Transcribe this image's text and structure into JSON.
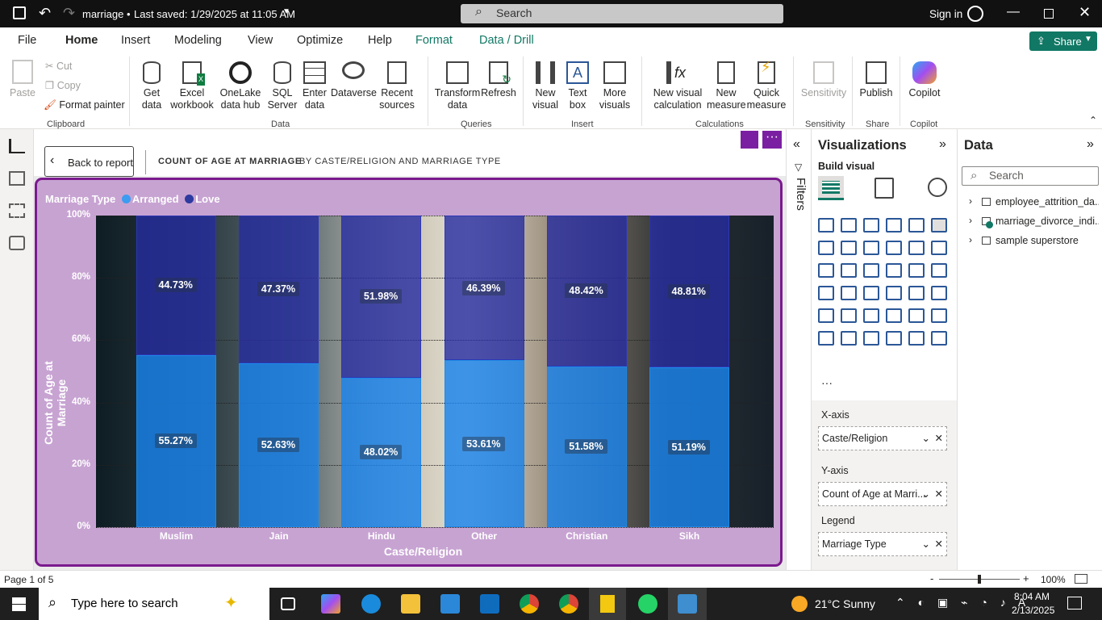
{
  "titlebar": {
    "file": "marriage",
    "saved": "Last saved: 1/29/2025 at 11:05 AM",
    "search": "Search",
    "signin": "Sign in"
  },
  "menu": {
    "file": "File",
    "home": "Home",
    "insert": "Insert",
    "modeling": "Modeling",
    "view": "View",
    "optimize": "Optimize",
    "help": "Help",
    "format": "Format",
    "datadrill": "Data / Drill",
    "share": "Share"
  },
  "ribbon": {
    "paste": "Paste",
    "cut": "Cut",
    "copy": "Copy",
    "format_painter": "Format painter",
    "clipboard": "Clipboard",
    "get_data": "Get data",
    "excel": "Excel workbook",
    "onelake": "OneLake data hub",
    "sql": "SQL Server",
    "enter": "Enter data",
    "dataverse": "Dataverse",
    "recent": "Recent sources",
    "data_grp": "Data",
    "transform": "Transform data",
    "refresh": "Refresh",
    "queries": "Queries",
    "new_visual": "New visual",
    "text_box": "Text box",
    "more_visuals": "More visuals",
    "insert_grp": "Insert",
    "new_calc": "New visual calculation",
    "new_measure": "New measure",
    "quick_measure": "Quick measure",
    "calc_grp": "Calculations",
    "sensitivity": "Sensitivity",
    "sens_grp": "Sensitivity",
    "publish": "Publish",
    "share_grp": "Share",
    "copilot": "Copilot",
    "copilot_grp": "Copilot"
  },
  "header": {
    "back": "Back to report",
    "title": "COUNT OF AGE AT MARRIAGE",
    "subtitle": "BY CASTE/RELIGION AND MARRIAGE TYPE"
  },
  "chart_data": {
    "type": "bar",
    "stacked": "100%",
    "legend_title": "Marriage Type",
    "categories": [
      "Muslim",
      "Jain",
      "Hindu",
      "Other",
      "Christian",
      "Sikh"
    ],
    "series": [
      {
        "name": "Arranged",
        "color": "#1e88e5",
        "values": [
          55.27,
          52.63,
          48.02,
          53.61,
          51.58,
          51.19
        ]
      },
      {
        "name": "Love",
        "color": "#283593",
        "values": [
          44.73,
          47.37,
          51.98,
          46.39,
          48.42,
          48.81
        ]
      }
    ],
    "data_labels_arranged": [
      "55.27%",
      "52.63%",
      "48.02%",
      "53.61%",
      "51.58%",
      "51.19%"
    ],
    "data_labels_love": [
      "44.73%",
      "47.37%",
      "51.98%",
      "46.39%",
      "48.42%",
      "48.81%"
    ],
    "yticks": [
      "100%",
      "80%",
      "60%",
      "40%",
      "20%",
      "0%"
    ],
    "ylim": [
      0,
      100
    ],
    "xlabel": "Caste/Religion",
    "ylabel": "Count of Age at Marriage",
    "grid": true,
    "legend_position": "top-left"
  },
  "filters": {
    "label": "Filters"
  },
  "viz": {
    "title": "Visualizations",
    "build": "Build visual",
    "xaxis": "X-axis",
    "xfield": "Caste/Religion",
    "yaxis": "Y-axis",
    "yfield": "Count of Age at Marri...",
    "legend": "Legend",
    "lfield": "Marriage Type"
  },
  "data_pane": {
    "title": "Data",
    "search": "Search",
    "tables": [
      "employee_attrition_da...",
      "marriage_divorce_indi...",
      "sample superstore"
    ]
  },
  "status": {
    "page": "Page 1 of 5",
    "zoom": "100%",
    "zoom_level": 0.5
  },
  "taskbar": {
    "search": "Type here to search",
    "weather": "21°C  Sunny",
    "time": "8:04 AM",
    "date": "2/13/2025"
  }
}
